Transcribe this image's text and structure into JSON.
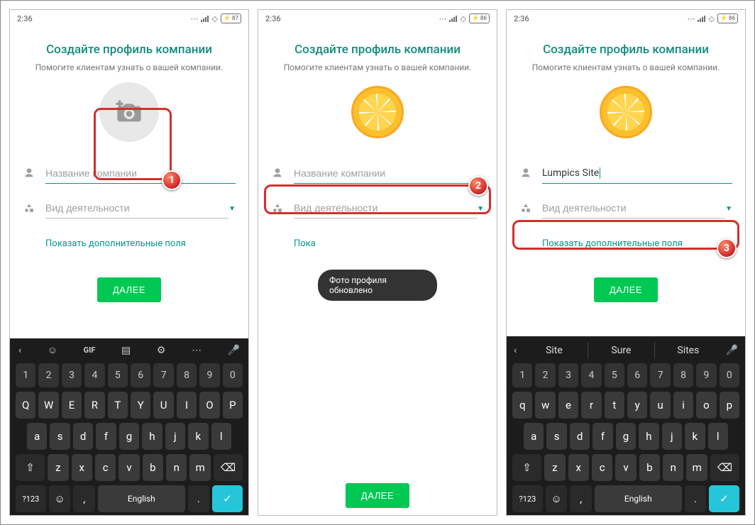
{
  "status": {
    "time": "2:36",
    "battery1": "87",
    "battery2": "86",
    "battery3": "86"
  },
  "profile": {
    "title": "Создайте профиль компании",
    "subtitle": "Помогите клиентам узнать о вашей компании.",
    "name_placeholder": "Название компании",
    "activity_placeholder": "Вид деятельности",
    "more_fields": "Показать дополнительные поля",
    "next": "ДАЛЕЕ"
  },
  "toast": {
    "photo_updated": "Фото профиля обновлено"
  },
  "phone2": {
    "more_partial": "Пока"
  },
  "phone3": {
    "company_value": "Lumpics Site"
  },
  "suggestions": [
    "Site",
    "Sure",
    "Sites"
  ],
  "keyboard": {
    "digits": [
      "1",
      "2",
      "3",
      "4",
      "5",
      "6",
      "7",
      "8",
      "9",
      "0"
    ],
    "row1": [
      "q",
      "w",
      "e",
      "r",
      "t",
      "y",
      "u",
      "i",
      "o",
      "p"
    ],
    "row1_caps": [
      "Q",
      "W",
      "E",
      "R",
      "T",
      "Y",
      "U",
      "I",
      "O",
      "P"
    ],
    "row2": [
      "a",
      "s",
      "d",
      "f",
      "g",
      "h",
      "j",
      "k",
      "l"
    ],
    "row3": [
      "z",
      "x",
      "c",
      "v",
      "b",
      "n",
      "m"
    ],
    "sym": "?123",
    "lang": "English",
    "gif": "GIF"
  },
  "badges": {
    "b1": "1",
    "b2": "2",
    "b3": "3"
  }
}
